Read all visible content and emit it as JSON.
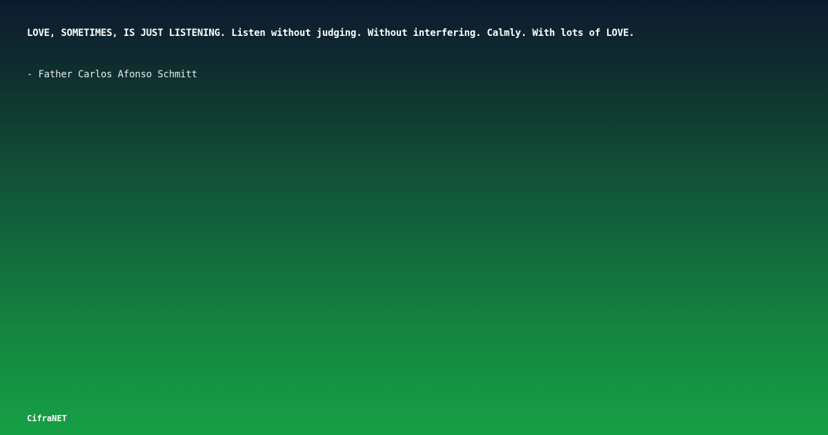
{
  "quote": {
    "text": "LOVE, SOMETIMES, IS JUST LISTENING. Listen without judging. Without interfering. Calmly. With lots of LOVE.",
    "author": "- Father Carlos Afonso Schmitt"
  },
  "brand": {
    "name": "CifraNET"
  },
  "colors": {
    "background_top": "#0d1a2e",
    "background_bottom": "#16a045",
    "text": "#ffffff"
  }
}
